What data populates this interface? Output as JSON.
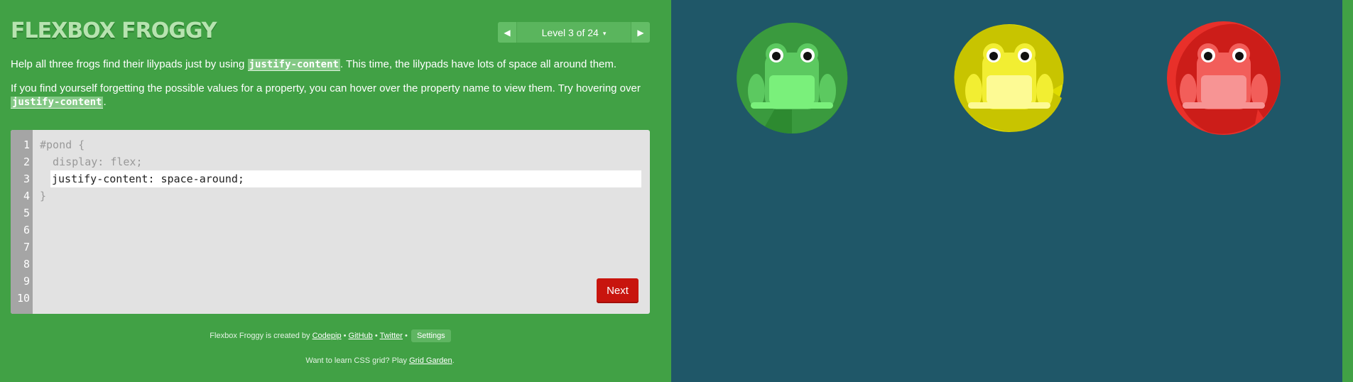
{
  "header": {
    "title": "FLEXBOX FROGGY",
    "level_label": "Level 3 of 24",
    "caret": "▾",
    "prev_arrow": "◀",
    "next_arrow": "▶"
  },
  "instructions": {
    "p1_before": "Help all three frogs find their lilypads just by using ",
    "p1_keyword": "justify-content",
    "p1_after": ". This time, the lilypads have lots of space all around them.",
    "p2_before": "If you find yourself forgetting the possible values for a property, you can hover over the property name to view them. Try hovering over ",
    "p2_keyword": "justify-content",
    "p2_after": "."
  },
  "editor": {
    "line_numbers": [
      "1",
      "2",
      "3",
      "4",
      "5",
      "6",
      "7",
      "8",
      "9",
      "10"
    ],
    "line1": "#pond {",
    "line2": "  display: flex;",
    "input_value": "justify-content: space-around;",
    "line4": "}",
    "next_label": "Next"
  },
  "footer": {
    "credit_prefix": "Flexbox Froggy is created by ",
    "codepip": "Codepip",
    "sep": " • ",
    "github": "GitHub",
    "twitter": "Twitter",
    "settings": "Settings",
    "grid_prefix": "Want to learn CSS grid? Play ",
    "grid_link": "Grid Garden",
    "grid_suffix": "."
  },
  "frogs": [
    {
      "color": "green",
      "pad": "#3a9a3e",
      "pad_dark": "#2d8a30",
      "body": "#5cc960",
      "belly": "#7af07b"
    },
    {
      "color": "yellow",
      "pad": "#e0dc00",
      "pad_dark": "#c8c400",
      "body": "#f2ee32",
      "belly": "#fdfa94"
    },
    {
      "color": "red",
      "pad": "#e8302a",
      "pad_dark": "#cc1d19",
      "body": "#f25e5a",
      "belly": "#f79494"
    }
  ],
  "colors": {
    "sidebar": "#41a145",
    "pond": "#1f5768",
    "next_button": "#c8150e"
  }
}
